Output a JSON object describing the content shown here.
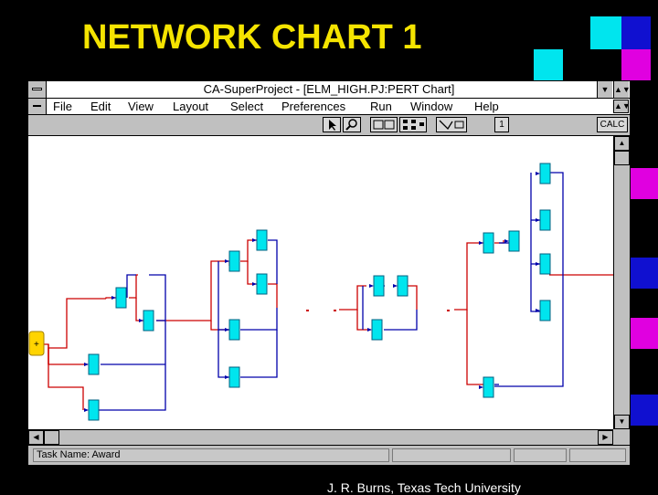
{
  "slide": {
    "title": "NETWORK CHART 1",
    "footer": "J. R. Burns, Texas Tech University"
  },
  "window": {
    "title": "CA-SuperProject - [ELM_HIGH.PJ:PERT Chart]",
    "menus": [
      "File",
      "Edit",
      "View",
      "Layout",
      "Select",
      "Preferences",
      "Run",
      "Window",
      "Help"
    ],
    "toolbar": {
      "calc_label": "CALC",
      "num_label": "1"
    },
    "status": {
      "task_name": "Task Name: Award"
    }
  },
  "colors": {
    "title_yellow": "#f5e400",
    "node_cyan": "#00e5ee",
    "link_red": "#cc0000",
    "link_blue": "#0000aa",
    "start_node": "#ffd400"
  }
}
